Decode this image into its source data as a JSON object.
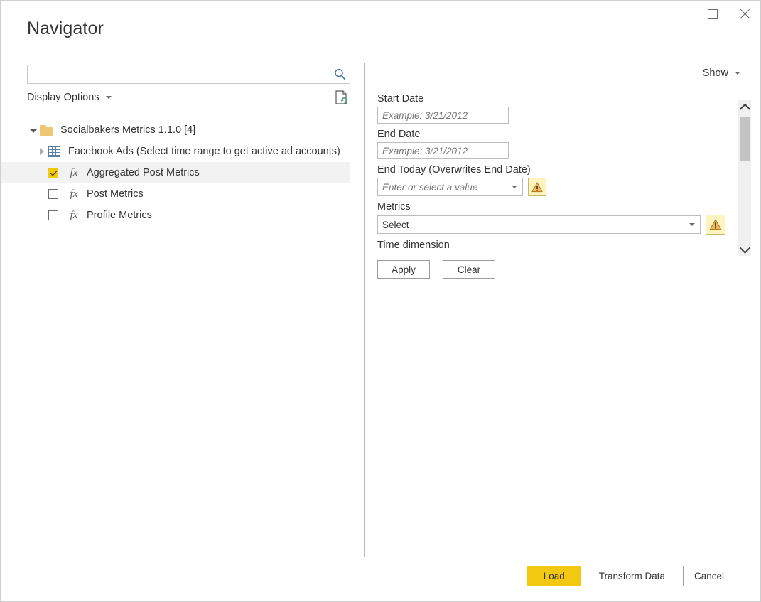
{
  "window": {
    "title": "Navigator",
    "controls": [
      {
        "name": "maximize",
        "icon": "maximize-icon"
      },
      {
        "name": "close",
        "icon": "close-icon"
      }
    ]
  },
  "left_pane": {
    "search": {
      "value": "",
      "placeholder": "",
      "icon": "search-icon"
    },
    "display_options": {
      "label": "Display Options",
      "caret_icon": "chevron-down-icon"
    },
    "refresh_icon": "refresh-document-icon",
    "tree": [
      {
        "label": "Socialbakers Metrics 1.1.0 [4]",
        "icon": "folder-icon",
        "expander": "triangle-expanded-icon",
        "level": 0,
        "type": "folder",
        "selected": false
      },
      {
        "label": "Facebook Ads (Select time range to get active ad accounts)",
        "icon": "table-icon",
        "expander": "triangle-collapsed-icon",
        "level": 1,
        "type": "table",
        "checked": false,
        "selected": false
      },
      {
        "label": "Aggregated Post Metrics",
        "icon": "function-icon",
        "level": 2,
        "type": "function",
        "checked": true,
        "selected": true
      },
      {
        "label": "Post Metrics",
        "icon": "function-icon",
        "level": 2,
        "type": "function",
        "checked": false,
        "selected": false
      },
      {
        "label": "Profile Metrics",
        "icon": "function-icon",
        "level": 2,
        "type": "function",
        "checked": false,
        "selected": false
      }
    ]
  },
  "right_pane": {
    "show": {
      "label": "Show",
      "caret_icon": "chevron-down-icon"
    },
    "fields": [
      {
        "label": "Start Date",
        "type": "textbox",
        "value": "",
        "placeholder": "Example: 3/21/2012",
        "warning": false
      },
      {
        "label": "End Date",
        "type": "textbox",
        "value": "",
        "placeholder": "Example: 3/21/2012",
        "warning": false
      },
      {
        "label": "End Today (Overwrites End Date)",
        "type": "combo-small",
        "value": "",
        "placeholder": "Enter or select a value",
        "warning": true
      },
      {
        "label": "Metrics",
        "type": "combo-wide",
        "value": "Select",
        "placeholder": "",
        "warning": true
      },
      {
        "label": "Time dimension",
        "type": "label-only",
        "value": "",
        "placeholder": "",
        "warning": false
      }
    ],
    "buttons": {
      "apply": "Apply",
      "clear": "Clear"
    },
    "scrollbar": {
      "up_icon": "chevron-up-icon",
      "down_icon": "chevron-down-icon"
    },
    "warning_icon": "warning-triangle-icon"
  },
  "footer": {
    "load": "Load",
    "transform": "Transform Data",
    "cancel": "Cancel"
  },
  "colors": {
    "accent_yellow": "#f2c811",
    "warning_bg": "#fdf4c0",
    "warning_border": "#c8b96a",
    "selection_bg": "#f2f2f2",
    "search_icon_blue": "#3a6ea5",
    "folder_yellow": "#f0c576",
    "table_icon_blue": "#5b7fa6"
  }
}
